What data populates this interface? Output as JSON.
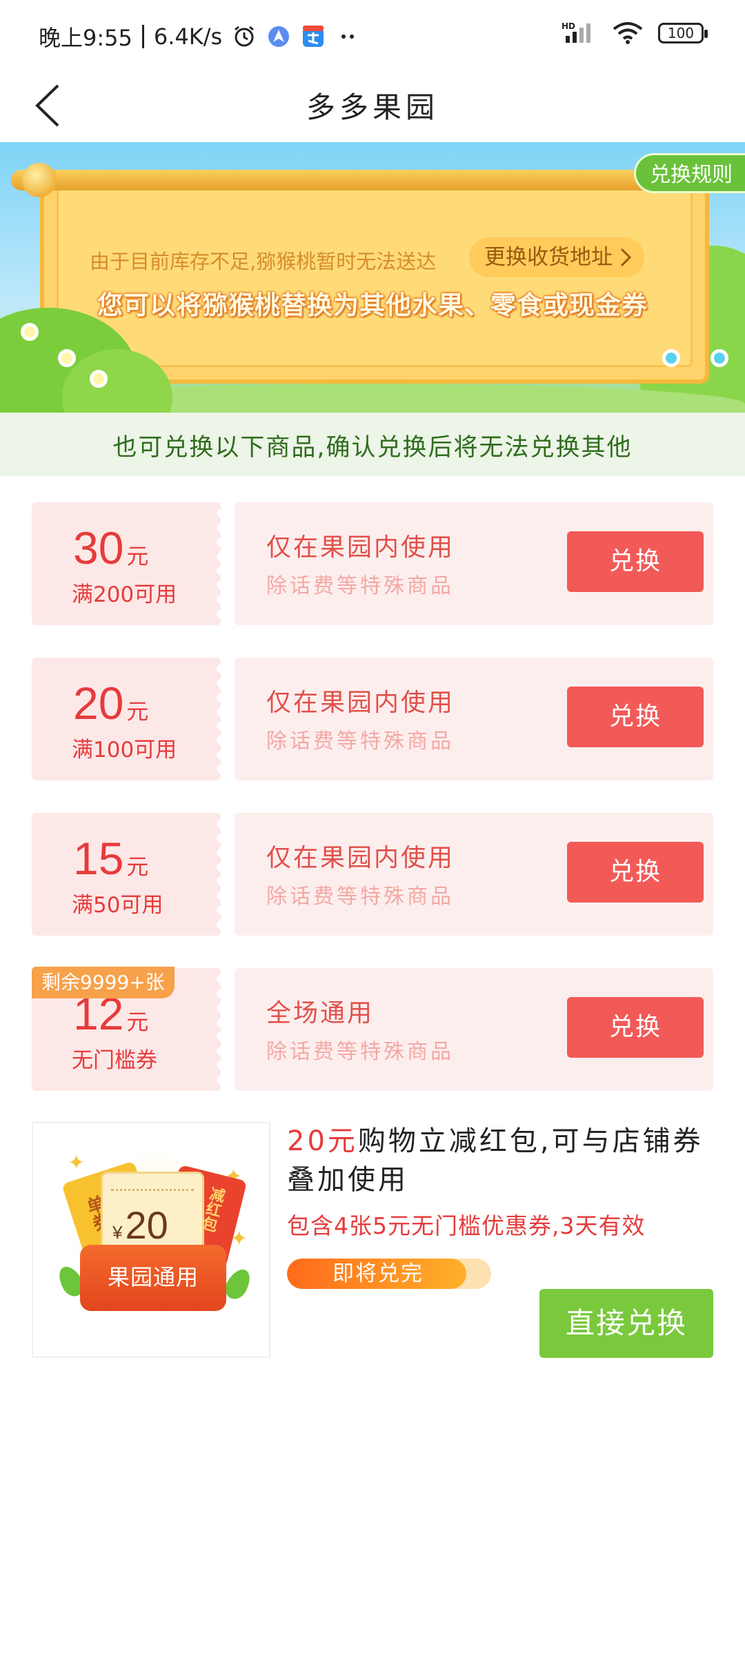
{
  "status_bar": {
    "time": "晚上9:55",
    "network_speed": "6.4K/s",
    "battery": "100",
    "icons": [
      "alarm-icon",
      "app-icon",
      "alipay-icon",
      "more-dots-icon",
      "hd-signal-icon",
      "wifi-icon",
      "battery-icon"
    ]
  },
  "header": {
    "title": "多多果园",
    "back_icon": "back-arrow-icon"
  },
  "banner": {
    "rules_label": "兑换规则",
    "notice": "由于目前库存不足,猕猴桃暂时无法送达",
    "change_address_label": "更换收货地址",
    "headline": "您可以将猕猴桃替换为其他水果、零食或现金券"
  },
  "notice_strip": {
    "text": "也可兑换以下商品,确认兑换后将无法兑换其他"
  },
  "coupons": [
    {
      "amount": "30",
      "unit": "元",
      "condition": "满200可用",
      "title": "仅在果园内使用",
      "subtitle": "除话费等特殊商品",
      "button": "兑换",
      "tag": ""
    },
    {
      "amount": "20",
      "unit": "元",
      "condition": "满100可用",
      "title": "仅在果园内使用",
      "subtitle": "除话费等特殊商品",
      "button": "兑换",
      "tag": ""
    },
    {
      "amount": "15",
      "unit": "元",
      "condition": "满50可用",
      "title": "仅在果园内使用",
      "subtitle": "除话费等特殊商品",
      "button": "兑换",
      "tag": ""
    },
    {
      "amount": "12",
      "unit": "元",
      "condition": "无门槛券",
      "title": "全场通用",
      "subtitle": "除话费等特殊商品",
      "button": "兑换",
      "tag": "剩余9999+张"
    }
  ],
  "red_packet": {
    "title_highlight": "20元",
    "title_rest": "购物立减红包,可与店铺券叠加使用",
    "description": "包含4张5元无门槛优惠券,3天有效",
    "progress_label": "即将兑完",
    "progress_fraction": 0.88,
    "button": "直接兑换",
    "image": {
      "currency_symbol": "¥",
      "value": "20",
      "pocket_text": "果园通用",
      "left_ticket_text": "单券",
      "right_ticket_text": "减红包"
    }
  },
  "colors": {
    "accent_red": "#f25a57",
    "coupon_bg": "#fdeeee",
    "green_button": "#7ac93d",
    "notice_green": "#2f6d1d"
  }
}
